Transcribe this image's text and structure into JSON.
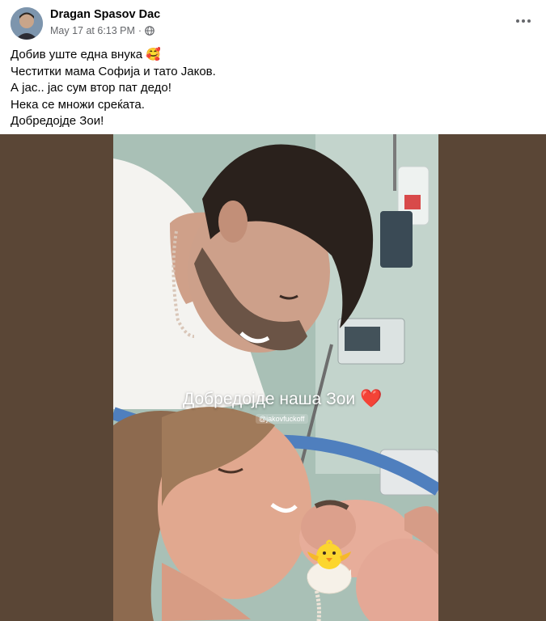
{
  "post": {
    "author": "Dragan Spasov Dac",
    "timestamp": "May 17 at 6:13 PM",
    "separator": "·",
    "audience_icon": "globe-icon",
    "menu_icon": "more-options-icon",
    "text_lines": [
      "Добив уште една внука 🥰",
      "Честитки мама Софија и тато Јаков.",
      "А јас.. јас сум втор пат дедо!",
      "Нека се множи среќата.",
      "Добредојде Зои!"
    ]
  },
  "photo": {
    "overlay_caption": "Добредојде наша Зои",
    "overlay_heart": "❤️",
    "overlay_tag": "@jakovfuckoff",
    "sticker": "hatching-chick"
  },
  "colors": {
    "side_background": "#5a4636",
    "author_text": "#050505",
    "meta_text": "#65676b"
  }
}
